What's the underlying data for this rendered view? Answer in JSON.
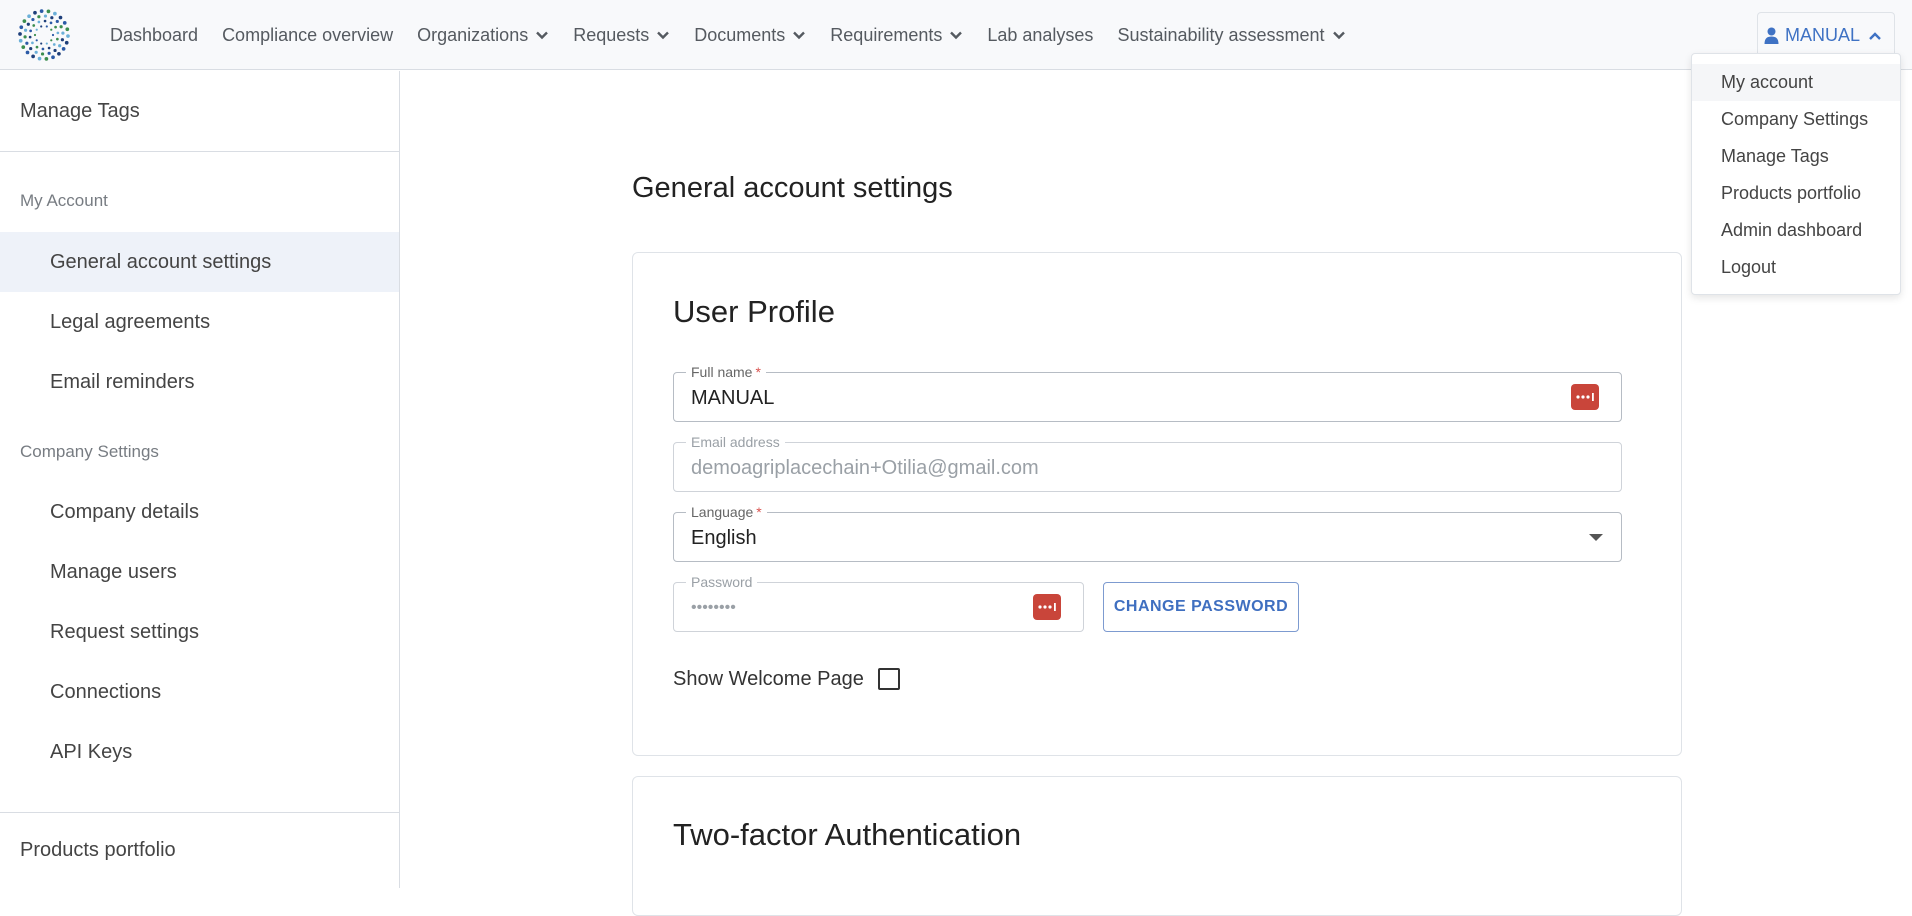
{
  "nav": {
    "items": [
      {
        "label": "Dashboard",
        "dropdown": false
      },
      {
        "label": "Compliance overview",
        "dropdown": false
      },
      {
        "label": "Organizations",
        "dropdown": true
      },
      {
        "label": "Requests",
        "dropdown": true
      },
      {
        "label": "Documents",
        "dropdown": true
      },
      {
        "label": "Requirements",
        "dropdown": true
      },
      {
        "label": "Lab analyses",
        "dropdown": false
      },
      {
        "label": "Sustainability assessment",
        "dropdown": true
      }
    ],
    "account_label": "MANUAL"
  },
  "account_menu": {
    "items": [
      "My account",
      "Company Settings",
      "Manage Tags",
      "Products portfolio",
      "Admin dashboard",
      "Logout"
    ]
  },
  "sidebar": {
    "top_label": "Manage Tags",
    "my_account_header": "My Account",
    "my_account_items": [
      "General account settings",
      "Legal agreements",
      "Email reminders"
    ],
    "company_header": "Company Settings",
    "company_items": [
      "Company details",
      "Manage users",
      "Request settings",
      "Connections",
      "API Keys"
    ],
    "bottom_label": "Products portfolio"
  },
  "main": {
    "page_title": "General account settings",
    "profile": {
      "title": "User Profile",
      "full_name_label": "Full name",
      "full_name_value": "MANUAL",
      "email_label": "Email address",
      "email_value": "demoagriplacechain+Otilia@gmail.com",
      "language_label": "Language",
      "language_value": "English",
      "password_label": "Password",
      "password_value": "••••••••",
      "change_password_label": "CHANGE PASSWORD",
      "show_welcome_label": "Show Welcome Page",
      "show_welcome_checked": false
    },
    "two_factor_title": "Two-factor Authentication"
  },
  "colors": {
    "accent": "#3f72c4",
    "password_badge": "#c9453a",
    "selected_bg": "#eef2f9"
  }
}
